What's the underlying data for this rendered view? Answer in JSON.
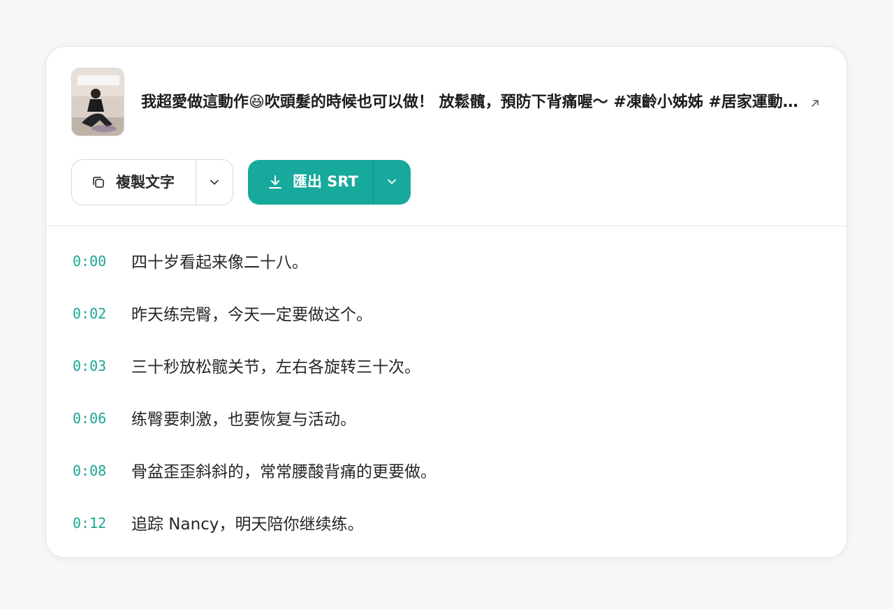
{
  "video": {
    "title": "我超愛做這動作😆吹頭髮的時候也可以做！ 放鬆髖，預防下背痛喔～ #凍齡小姊姊 #居家運動 #放鬆髖關節",
    "thumbnail_icon": "video-thumbnail",
    "external_icon": "external-link-icon"
  },
  "toolbar": {
    "copy_label": "複製文字",
    "export_label": "匯出 SRT"
  },
  "colors": {
    "accent": "#17a99b",
    "timestamp": "#1aa596"
  },
  "transcript": [
    {
      "time": "0:00",
      "text": "四十岁看起来像二十八。"
    },
    {
      "time": "0:02",
      "text": "昨天练完臀，今天一定要做这个。"
    },
    {
      "time": "0:03",
      "text": "三十秒放松髋关节，左右各旋转三十次。"
    },
    {
      "time": "0:06",
      "text": "练臀要刺激，也要恢复与活动。"
    },
    {
      "time": "0:08",
      "text": "骨盆歪歪斜斜的，常常腰酸背痛的更要做。"
    },
    {
      "time": "0:12",
      "text": "追踪 Nancy，明天陪你继续练。"
    }
  ]
}
